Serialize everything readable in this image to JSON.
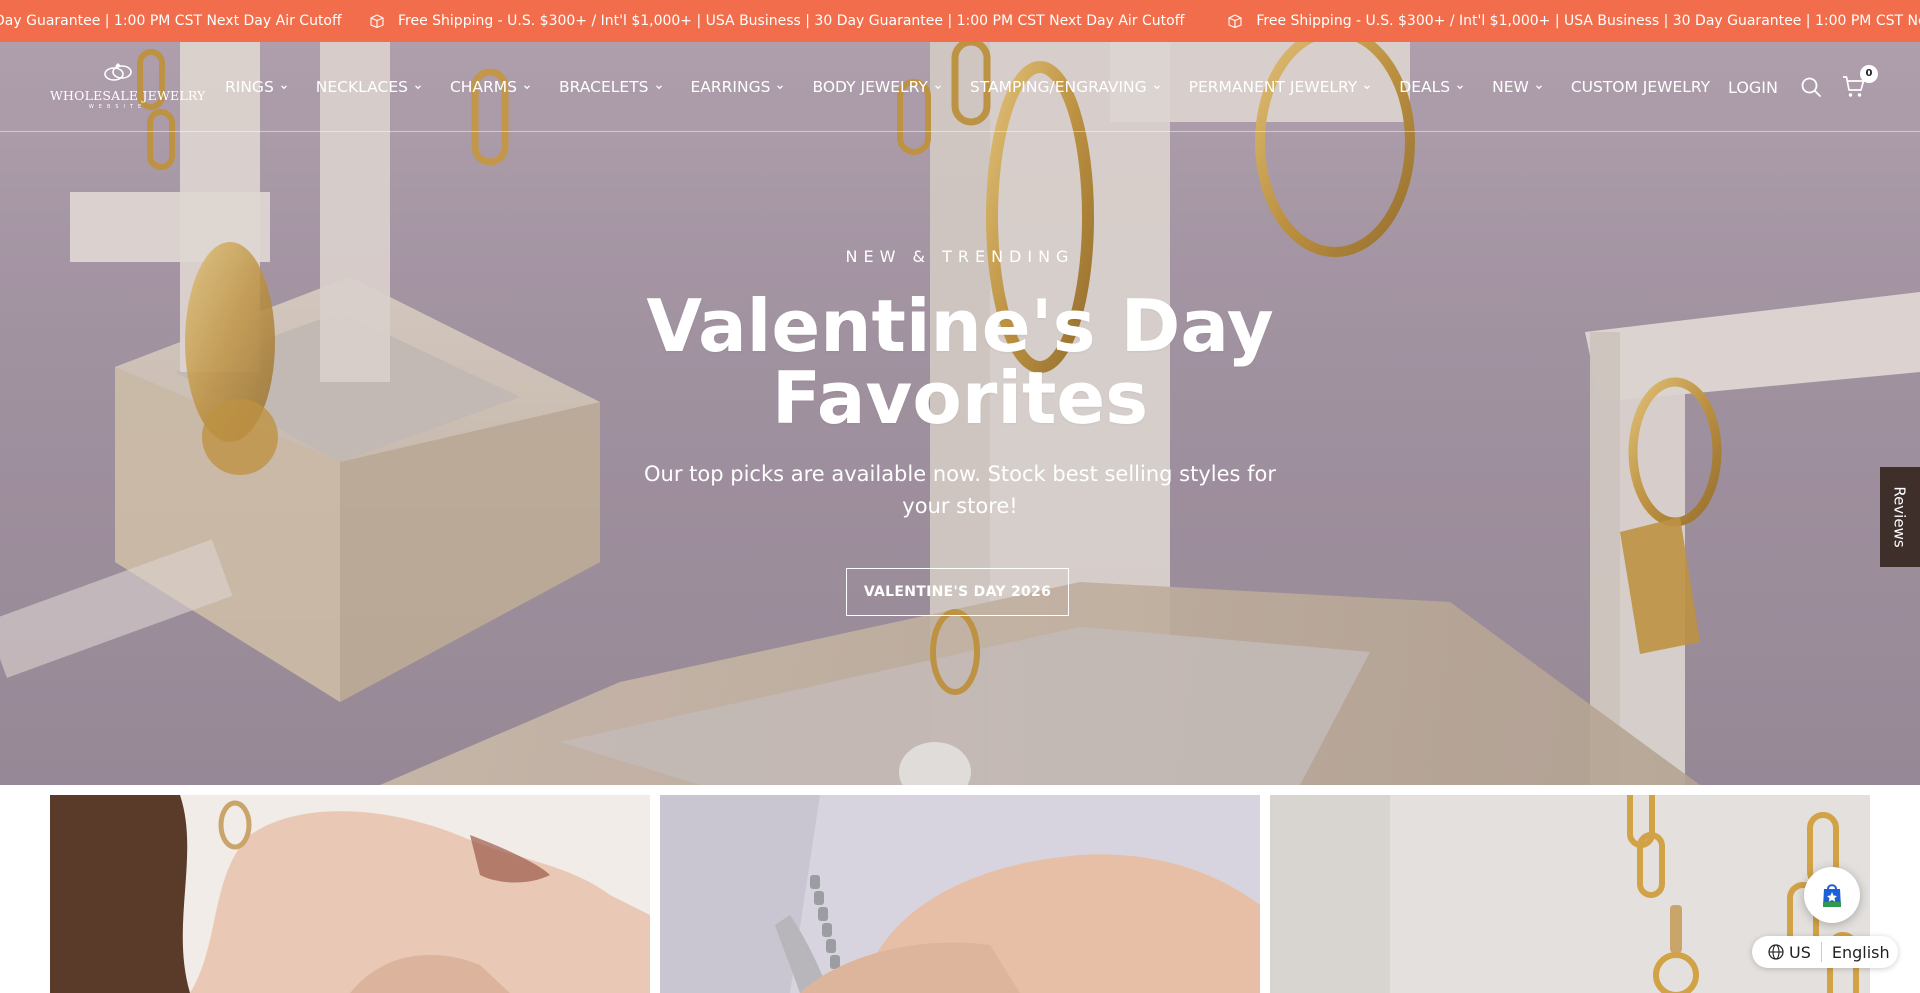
{
  "announcement": {
    "lead_fragment": "Day Guarantee | 1:00 PM CST Next Day Air Cutoff",
    "message": "Free Shipping - U.S. $300+ / Int'l $1,000+ | USA Business | 30 Day Guarantee | 1:00 PM CST Next Day Air Cutoff",
    "icon": "box-icon",
    "background": "#f26d4b"
  },
  "header": {
    "logo_text": "WHOLESALE JEWELRY",
    "logo_sub": "WEBSITE",
    "nav": [
      {
        "label": "RINGS",
        "has_dropdown": true
      },
      {
        "label": "NECKLACES",
        "has_dropdown": true
      },
      {
        "label": "CHARMS",
        "has_dropdown": true
      },
      {
        "label": "BRACELETS",
        "has_dropdown": true
      },
      {
        "label": "EARRINGS",
        "has_dropdown": true
      },
      {
        "label": "BODY JEWELRY",
        "has_dropdown": true
      },
      {
        "label": "STAMPING/ENGRAVING",
        "has_dropdown": true
      },
      {
        "label": "PERMANENT JEWELRY",
        "has_dropdown": true
      },
      {
        "label": "DEALS",
        "has_dropdown": true
      },
      {
        "label": "NEW",
        "has_dropdown": true
      },
      {
        "label": "CUSTOM JEWELRY",
        "has_dropdown": false
      }
    ],
    "login_label": "LOGIN",
    "cart_count": "0"
  },
  "hero": {
    "eyebrow": "NEW & TRENDING",
    "headline_line1": "Valentine's Day",
    "headline_line2": "Favorites",
    "subhead": "Our top picks are available now. Stock best selling styles for your store!",
    "cta_label": "VALENTINE'S DAY 2026"
  },
  "reviews_tab": {
    "label": "Reviews"
  },
  "locale": {
    "country": "US",
    "language": "English"
  }
}
